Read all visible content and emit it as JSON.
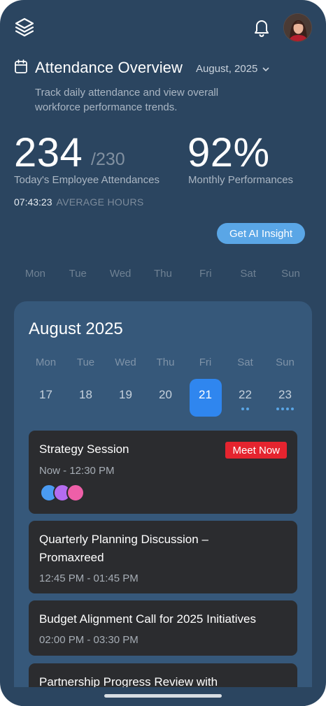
{
  "topbar": {
    "logo_icon": "layers-icon",
    "notification_icon": "bell-icon",
    "avatar_icon": "user-avatar"
  },
  "header": {
    "calendar_icon": "calendar-icon",
    "title": "Attendance Overview",
    "month": "August, 2025",
    "subtitle": "Track daily attendance and view overall workforce performance trends."
  },
  "stats": {
    "attendance": "234",
    "attendance_total": "/230",
    "attendance_label": "Today's Employee Attendances",
    "performance": "92%",
    "performance_label": "Monthly Performances",
    "average_time": "07:43:23",
    "average_label": "AVERAGE HOURS"
  },
  "ai_button_label": "Get AI Insight",
  "week_labels": [
    "Mon",
    "Tue",
    "Wed",
    "Thu",
    "Fri",
    "Sat",
    "Sun"
  ],
  "calendar": {
    "title": "August 2025",
    "weekday_labels": [
      "Mon",
      "Tue",
      "Wed",
      "Thu",
      "Fri",
      "Sat",
      "Sun"
    ],
    "dates": [
      {
        "day": "17",
        "dots": 0,
        "selected": false
      },
      {
        "day": "18",
        "dots": 0,
        "selected": false
      },
      {
        "day": "19",
        "dots": 0,
        "selected": false
      },
      {
        "day": "20",
        "dots": 0,
        "selected": false
      },
      {
        "day": "21",
        "dots": 0,
        "selected": true
      },
      {
        "day": "22",
        "dots": 2,
        "selected": false
      },
      {
        "day": "23",
        "dots": 4,
        "selected": false
      }
    ],
    "selected_color": "#2f86ef"
  },
  "events": [
    {
      "title": "Strategy Session",
      "time": "Now - 12:30 PM",
      "action": "Meet Now",
      "participants": [
        "#4a9bf2",
        "#b46cf0",
        "#ee5fa8"
      ]
    },
    {
      "title": "Quarterly Planning Discussion – Promaxreed",
      "time": "12:45 PM - 01:45 PM"
    },
    {
      "title": "Budget Alignment Call for 2025 Initiatives",
      "time": "02:00 PM - 03:30 PM"
    },
    {
      "title": "Partnership Progress Review with",
      "time": ""
    }
  ],
  "colors": {
    "background": "#2b4560",
    "card": "#36587a",
    "accent": "#5aa6e6",
    "danger": "#e5242f",
    "event_card": "#2b2c2f"
  }
}
